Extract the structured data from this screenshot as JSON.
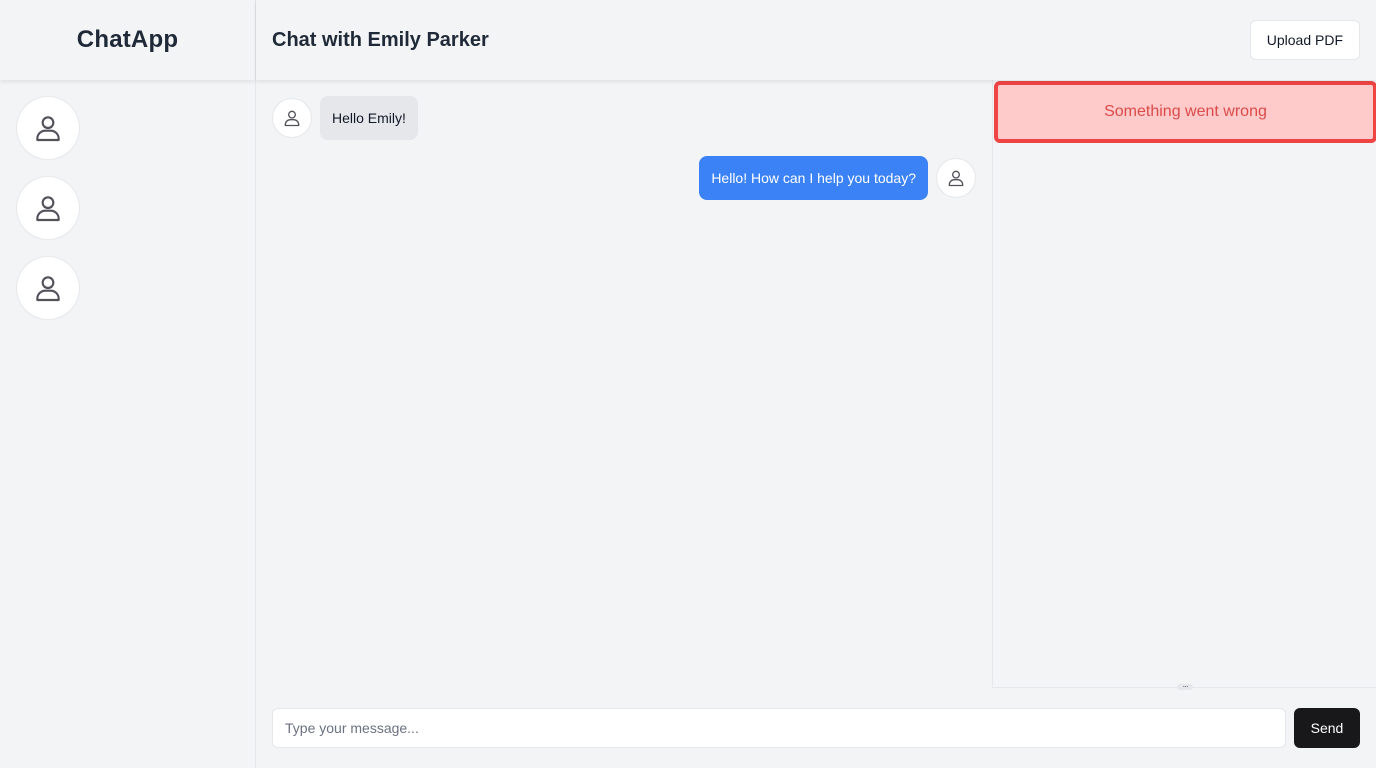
{
  "app": {
    "name": "ChatApp"
  },
  "sidebar": {
    "contacts": [
      {
        "icon": "user-icon"
      },
      {
        "icon": "user-icon"
      },
      {
        "icon": "user-icon"
      }
    ]
  },
  "header": {
    "title": "Chat with Emily Parker",
    "upload_label": "Upload PDF"
  },
  "messages": [
    {
      "direction": "incoming",
      "text": "Hello Emily!",
      "avatar_icon": "user-icon"
    },
    {
      "direction": "outgoing",
      "text": "Hello! How can I help you today?",
      "avatar_icon": "user-icon"
    }
  ],
  "panel": {
    "error_text": "Something went wrong",
    "handle_glyph": "···"
  },
  "composer": {
    "placeholder": "Type your message...",
    "value": "",
    "send_label": "Send"
  },
  "colors": {
    "outgoing_bubble": "#3b82f6",
    "incoming_bubble": "#e5e7eb",
    "error_border": "#ef4444",
    "error_bg": "#fecaca",
    "send_button": "#18181b"
  }
}
